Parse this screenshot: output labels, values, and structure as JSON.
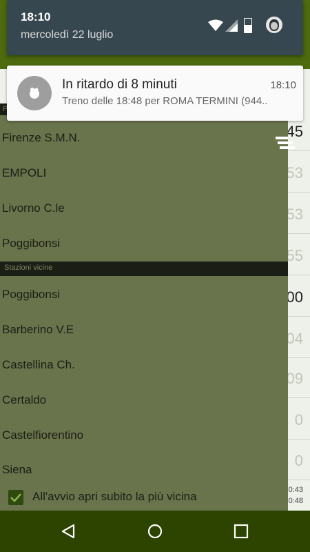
{
  "status": {
    "time": "18:10",
    "date": "mercoledì 22 luglio",
    "battery_label": "45"
  },
  "notification": {
    "title": "In ritardo di 8 minuti",
    "time": "18:10",
    "text": "Treno delle 18:48 per ROMA TERMINI (944.."
  },
  "background_times": [
    "45",
    "53",
    "53",
    "55",
    "00",
    "04",
    "09",
    "0",
    "0"
  ],
  "background_small_times": [
    "0:43",
    "0:48"
  ],
  "drawer": {
    "top_header": "P",
    "recent_stations": [
      "Firenze S.M.N.",
      "EMPOLI",
      "Livorno C.le",
      "Poggibonsi"
    ],
    "nearby_header": "Stazioni vicine",
    "nearby_stations": [
      "Poggibonsi",
      "Barberino V.E",
      "Castellina Ch.",
      "Certaldo",
      "Castelfiorentino",
      "Siena"
    ],
    "checkbox_label": "All'avvio apri subito la più vicina",
    "checkbox_checked": true
  },
  "colors": {
    "drawer_bg": "#69734c",
    "nav_bg": "#2d4300",
    "shade_bg": "#37474f",
    "accent": "#2f4a0f"
  },
  "icons": {
    "nav": [
      "back-icon",
      "home-icon",
      "recents-icon"
    ],
    "status": [
      "wifi-icon",
      "signal-icon",
      "battery-icon",
      "avatar-icon"
    ],
    "notification": "app-icon",
    "menu": "menu-icon",
    "checkbox": "check-icon"
  }
}
